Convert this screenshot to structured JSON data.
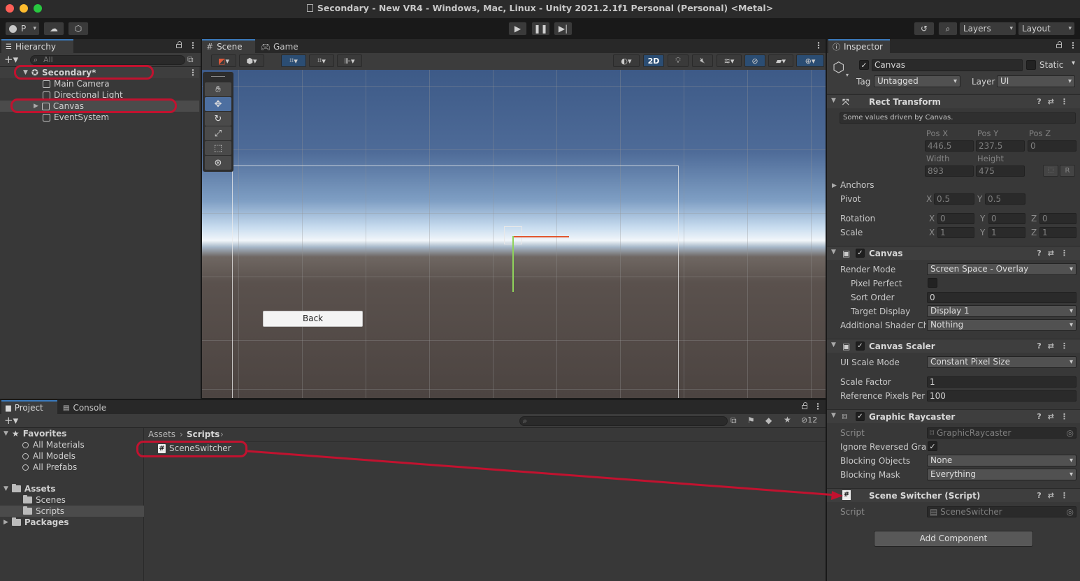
{
  "window": {
    "title": "Secondary - New VR4 - Windows, Mac, Linux - Unity 2021.2.1f1 Personal (Personal) <Metal>",
    "traffic_colors": [
      "#fe5f57",
      "#febc2e",
      "#28c840"
    ]
  },
  "toolbar": {
    "account_label": "P",
    "layers_label": "Layers",
    "layout_label": "Layout",
    "play_icon": "play-icon",
    "pause_icon": "pause-icon",
    "step_icon": "step-icon"
  },
  "hierarchy": {
    "tab_label": "Hierarchy",
    "search_placeholder": "All",
    "items": [
      {
        "label": "Secondary*",
        "type": "scene"
      },
      {
        "label": "Main Camera",
        "type": "gameobject"
      },
      {
        "label": "Directional Light",
        "type": "gameobject"
      },
      {
        "label": "Canvas",
        "type": "gameobject"
      },
      {
        "label": "EventSystem",
        "type": "gameobject"
      }
    ]
  },
  "scene_view": {
    "tabs": [
      {
        "label": "Scene"
      },
      {
        "label": "Game"
      }
    ],
    "mode_2d_label": "2D",
    "back_button_label": "Back"
  },
  "inspector": {
    "tab_label": "Inspector",
    "object_name": "Canvas",
    "static_label": "Static",
    "tag_label": "Tag",
    "tag_value": "Untagged",
    "layer_label": "Layer",
    "layer_value": "UI",
    "rect_transform": {
      "title": "Rect Transform",
      "driven_note": "Some values driven by Canvas.",
      "pos_x_label": "Pos X",
      "pos_y_label": "Pos Y",
      "pos_z_label": "Pos Z",
      "pos_x": "446.5",
      "pos_y": "237.5",
      "pos_z": "0",
      "width_label": "Width",
      "height_label": "Height",
      "width": "893",
      "height": "475",
      "r_label": "R",
      "anchors_label": "Anchors",
      "pivot_label": "Pivot",
      "pivot_x": "0.5",
      "pivot_y": "0.5",
      "rotation_label": "Rotation",
      "rot_x": "0",
      "rot_y": "0",
      "rot_z": "0",
      "scale_label": "Scale",
      "scale_x": "1",
      "scale_y": "1",
      "scale_z": "1",
      "x_label": "X",
      "y_label": "Y",
      "z_label": "Z"
    },
    "canvas": {
      "title": "Canvas",
      "render_mode_label": "Render Mode",
      "render_mode": "Screen Space - Overlay",
      "pixel_perfect_label": "Pixel Perfect",
      "sort_order_label": "Sort Order",
      "sort_order": "0",
      "target_display_label": "Target Display",
      "target_display": "Display 1",
      "shader_channels_label": "Additional Shader Cha",
      "shader_channels": "Nothing"
    },
    "canvas_scaler": {
      "title": "Canvas Scaler",
      "ui_scale_mode_label": "UI Scale Mode",
      "ui_scale_mode": "Constant Pixel Size",
      "scale_factor_label": "Scale Factor",
      "scale_factor": "1",
      "ref_ppu_label": "Reference Pixels Per U",
      "ref_ppu": "100"
    },
    "graphic_raycaster": {
      "title": "Graphic Raycaster",
      "script_label": "Script",
      "script": "GraphicRaycaster",
      "ignore_reversed_label": "Ignore Reversed Grapl",
      "blocking_objects_label": "Blocking Objects",
      "blocking_objects": "None",
      "blocking_mask_label": "Blocking Mask",
      "blocking_mask": "Everything"
    },
    "scene_switcher": {
      "title": "Scene Switcher (Script)",
      "script_label": "Script",
      "script": "SceneSwitcher"
    },
    "add_component_label": "Add Component"
  },
  "project": {
    "tabs": [
      {
        "label": "Project"
      },
      {
        "label": "Console"
      }
    ],
    "hidden_count": "12",
    "favorites_label": "Favorites",
    "favorites": [
      "All Materials",
      "All Models",
      "All Prefabs"
    ],
    "assets_label": "Assets",
    "asset_folders": [
      "Scenes",
      "Scripts"
    ],
    "packages_label": "Packages",
    "breadcrumb": [
      "Assets",
      "Scripts"
    ],
    "files": [
      "SceneSwitcher"
    ]
  },
  "annotation_color": "#c1122f"
}
